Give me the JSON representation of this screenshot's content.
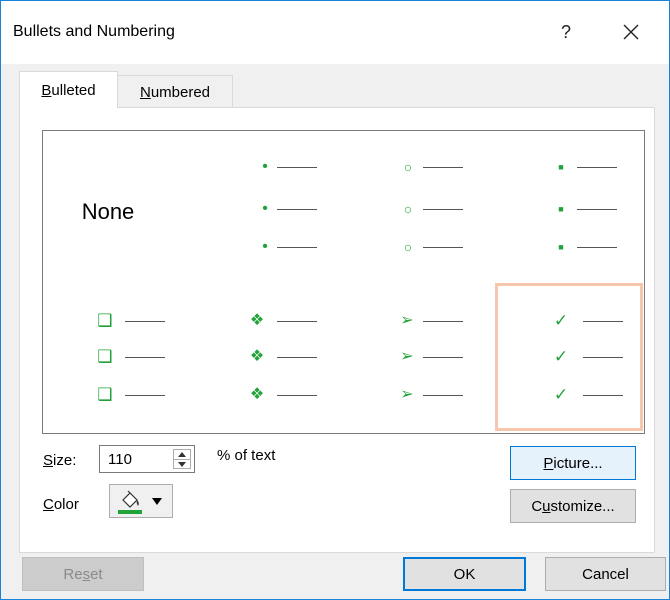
{
  "dialog": {
    "title": "Bullets and Numbering",
    "help_label": "?"
  },
  "tabs": [
    {
      "label_underlined": "B",
      "label_rest": "ulleted",
      "active": true
    },
    {
      "label_underlined": "N",
      "label_rest": "umbered",
      "active": false
    }
  ],
  "gallery": {
    "none_label": "None",
    "bullet_color": "#21a33a",
    "selected_outline_color": "#f7c7ad",
    "items": [
      {
        "icon": "none"
      },
      {
        "icon": "small-dot-bullet",
        "glyph": "•"
      },
      {
        "icon": "hollow-circle-bullet",
        "glyph": "○"
      },
      {
        "icon": "filled-square-bullet",
        "glyph": "■"
      },
      {
        "icon": "hollow-square-bullet",
        "glyph": "❑"
      },
      {
        "icon": "four-diamond-bullet",
        "glyph": "❖"
      },
      {
        "icon": "arrowhead-bullet",
        "glyph": "➢"
      },
      {
        "icon": "checkmark-bullet",
        "glyph": "✓",
        "selected": true
      }
    ]
  },
  "size": {
    "label_underlined": "S",
    "label_rest": "ize:",
    "value": "110",
    "suffix": "% of text"
  },
  "color": {
    "label_underlined": "C",
    "label_rest": "olor",
    "swatch": "#21a33a"
  },
  "buttons": {
    "picture_u": "P",
    "picture_rest": "icture...",
    "customize_a": "C",
    "customize_u": "u",
    "customize_rest": "stomize...",
    "reset_a": "Re",
    "reset_u": "s",
    "reset_rest": "et",
    "ok": "OK",
    "cancel": "Cancel"
  }
}
